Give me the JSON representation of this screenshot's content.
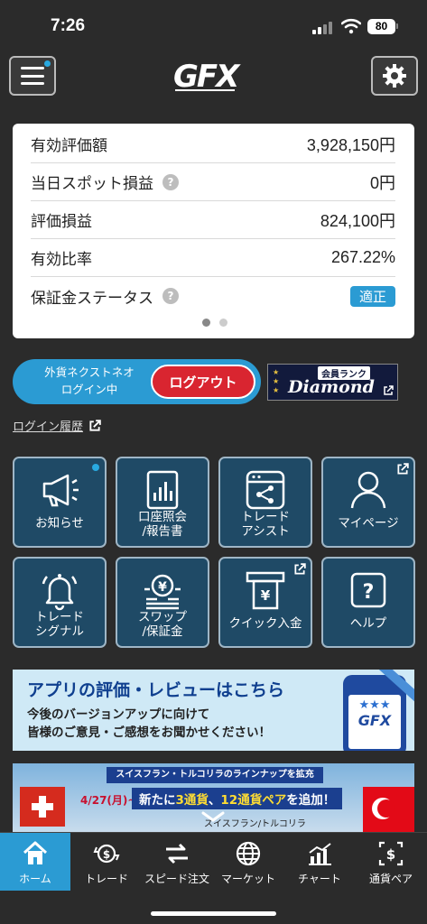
{
  "status_bar": {
    "time": "7:26",
    "battery": "80"
  },
  "header": {
    "logo": "GFX"
  },
  "summary": {
    "rows": [
      {
        "label": "有効評価額",
        "value": "3,928,150円",
        "help": false
      },
      {
        "label": "当日スポット損益",
        "value": "0円",
        "help": true
      },
      {
        "label": "評価損益",
        "value": "824,100円",
        "help": false
      },
      {
        "label": "有効比率",
        "value": "267.22%",
        "help": false
      },
      {
        "label": "保証金ステータス",
        "value": "適正",
        "help": true
      }
    ],
    "help_glyph": "?",
    "pager": {
      "pages": 2,
      "current": 1
    }
  },
  "login": {
    "line1": "外貨ネクストネオ",
    "line2": "ログイン中",
    "logout_label": "ログアウト"
  },
  "rank": {
    "title": "会員ランク",
    "name": "Diamond"
  },
  "history_link": "ログイン履歴",
  "tiles": [
    {
      "label": "お知らせ",
      "icon": "megaphone-icon"
    },
    {
      "label": "口座照会\n/報告書",
      "icon": "document-chart-icon"
    },
    {
      "label": "トレード\nアシスト",
      "icon": "share-window-icon"
    },
    {
      "label": "マイページ",
      "icon": "person-icon"
    },
    {
      "label": "トレード\nシグナル",
      "icon": "bell-icon"
    },
    {
      "label": "スワップ\n/保証金",
      "icon": "yen-coins-icon"
    },
    {
      "label": "クイック入金",
      "icon": "atm-yen-icon"
    },
    {
      "label": "ヘルプ",
      "icon": "help-icon"
    }
  ],
  "banner_review": {
    "title": "アプリの評価・レビューはこちら",
    "line1": "今後のバージョンアップに向けて",
    "line2": "皆様のご意見・ご感想をお聞かせください！",
    "logo": "GFX"
  },
  "banner_currency": {
    "header": "スイスフラン・トルコリラのラインナップを拡充",
    "date": "4/27(月)~",
    "main_prefix": "新たに",
    "main_a": "3通貨",
    "main_mid": "、",
    "main_b": "12通貨ペア",
    "main_suffix": "を追加！",
    "sub": "スイスフラン/トルコリラ"
  },
  "tabbar": {
    "items": [
      {
        "label": "ホーム",
        "icon": "home-icon",
        "active": true
      },
      {
        "label": "トレード",
        "icon": "trade-icon",
        "active": false
      },
      {
        "label": "スピード注文",
        "icon": "speed-order-icon",
        "active": false
      },
      {
        "label": "マーケット",
        "icon": "globe-icon",
        "active": false
      },
      {
        "label": "チャート",
        "icon": "chart-icon",
        "active": false
      },
      {
        "label": "通貨ペア",
        "icon": "currency-pair-icon",
        "active": false
      }
    ]
  },
  "colors": {
    "accent": "#2b9bd3",
    "tile_bg": "#1f4a66",
    "logout": "#d92530",
    "background": "#2b2b2b"
  }
}
